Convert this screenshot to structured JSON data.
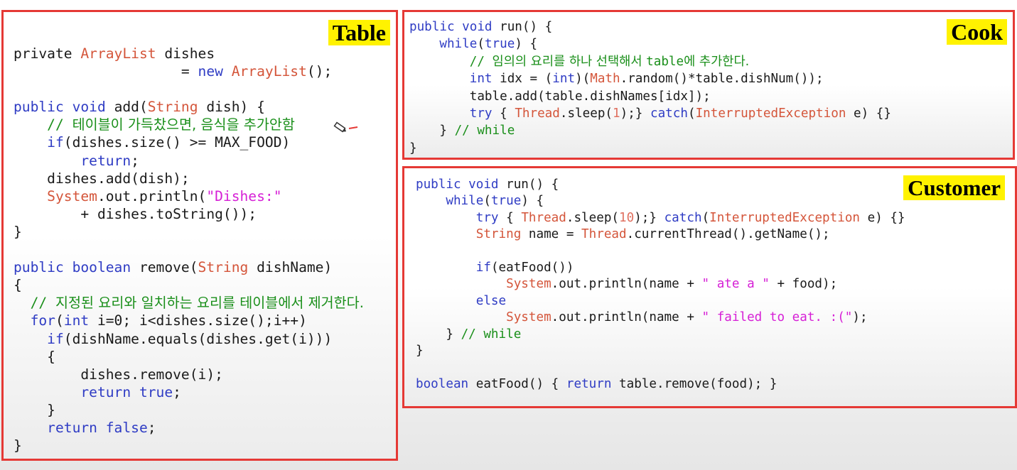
{
  "panels": {
    "table": {
      "tag": "Table"
    },
    "cook": {
      "tag": "Cook"
    },
    "customer": {
      "tag": "Customer"
    }
  },
  "code": {
    "table": [
      [
        [
          "",
          "private "
        ],
        [
          "ty",
          "ArrayList"
        ],
        [
          "",
          " dishes"
        ]
      ],
      [
        [
          "",
          "                    = "
        ],
        [
          "kw",
          "new "
        ],
        [
          "ty",
          "ArrayList"
        ],
        [
          "",
          "();"
        ]
      ],
      [],
      [
        [
          "kw",
          "public void "
        ],
        [
          "",
          "add("
        ],
        [
          "ty",
          "String"
        ],
        [
          "",
          " dish) {"
        ]
      ],
      [
        [
          "cm",
          "    // "
        ],
        [
          "cm-kr",
          "테이블이 가득찼으면, 음식을 추가안함"
        ]
      ],
      [
        [
          "kw",
          "    if"
        ],
        [
          "",
          "(dishes.size() >= MAX_FOOD)"
        ]
      ],
      [
        [
          "kw",
          "        return"
        ],
        [
          "",
          ";"
        ]
      ],
      [
        [
          "",
          "    dishes.add(dish);"
        ]
      ],
      [
        [
          "ty",
          "    System"
        ],
        [
          "",
          ".out.println("
        ],
        [
          "st",
          "\"Dishes:\""
        ]
      ],
      [
        [
          "",
          "        + dishes.toString());"
        ]
      ],
      [
        [
          "",
          "}"
        ]
      ],
      [],
      [
        [
          "kw",
          "public boolean "
        ],
        [
          "",
          "remove("
        ],
        [
          "ty",
          "String"
        ],
        [
          "",
          " dishName)"
        ]
      ],
      [
        [
          "",
          "{"
        ]
      ],
      [
        [
          "cm",
          "  // "
        ],
        [
          "cm-kr",
          "지정된 요리와 일치하는 요리를 테이블에서 제거한다."
        ]
      ],
      [
        [
          "kw",
          "  for"
        ],
        [
          "",
          "("
        ],
        [
          "kw",
          "int"
        ],
        [
          "",
          " i=0; i<dishes.size();i++)"
        ]
      ],
      [
        [
          "kw",
          "    if"
        ],
        [
          "",
          "(dishName.equals(dishes.get(i)))"
        ]
      ],
      [
        [
          "",
          "    {"
        ]
      ],
      [
        [
          "",
          "        dishes.remove(i);"
        ]
      ],
      [
        [
          "kw",
          "        return true"
        ],
        [
          "",
          ";"
        ]
      ],
      [
        [
          "",
          "    }"
        ]
      ],
      [
        [
          "kw",
          "    return false"
        ],
        [
          "",
          ";"
        ]
      ],
      [
        [
          "",
          "}"
        ]
      ]
    ],
    "cook": [
      [
        [
          "kw",
          "public void "
        ],
        [
          "",
          "run() {"
        ]
      ],
      [
        [
          "kw",
          "    while"
        ],
        [
          "",
          "("
        ],
        [
          "kw",
          "true"
        ],
        [
          "",
          ") {"
        ]
      ],
      [
        [
          "cm",
          "        // "
        ],
        [
          "cm-kr",
          "임의의 요리를 하나 선택해서 "
        ],
        [
          "cm",
          "table"
        ],
        [
          "cm-kr",
          "에 추가한다."
        ]
      ],
      [
        [
          "kw",
          "        int"
        ],
        [
          "",
          " idx = ("
        ],
        [
          "kw",
          "int"
        ],
        [
          "",
          ")("
        ],
        [
          "ty",
          "Math"
        ],
        [
          "",
          ".random()*table.dishNum());"
        ]
      ],
      [
        [
          "",
          "        table.add(table.dishNames[idx]);"
        ]
      ],
      [
        [
          "kw",
          "        try"
        ],
        [
          "",
          " { "
        ],
        [
          "ty",
          "Thread"
        ],
        [
          "",
          ".sleep("
        ],
        [
          "nm",
          "1"
        ],
        [
          "",
          ");} "
        ],
        [
          "kw",
          "catch"
        ],
        [
          "",
          "("
        ],
        [
          "ty",
          "InterruptedException"
        ],
        [
          "",
          " e) {}"
        ]
      ],
      [
        [
          "",
          "    } "
        ],
        [
          "cm",
          "// while"
        ]
      ],
      [
        [
          "",
          "}"
        ]
      ]
    ],
    "customer": [
      [
        [
          "kw",
          "public void "
        ],
        [
          "",
          "run() {"
        ]
      ],
      [
        [
          "kw",
          "    while"
        ],
        [
          "",
          "("
        ],
        [
          "kw",
          "true"
        ],
        [
          "",
          ") {"
        ]
      ],
      [
        [
          "kw",
          "        try"
        ],
        [
          "",
          " { "
        ],
        [
          "ty",
          "Thread"
        ],
        [
          "",
          ".sleep("
        ],
        [
          "nm",
          "10"
        ],
        [
          "",
          ");} "
        ],
        [
          "kw",
          "catch"
        ],
        [
          "",
          "("
        ],
        [
          "ty",
          "InterruptedException"
        ],
        [
          "",
          " e) {}"
        ]
      ],
      [
        [
          "ty",
          "        String"
        ],
        [
          "",
          " name = "
        ],
        [
          "ty",
          "Thread"
        ],
        [
          "",
          ".currentThread().getName();"
        ]
      ],
      [],
      [
        [
          "kw",
          "        if"
        ],
        [
          "",
          "(eatFood())"
        ]
      ],
      [
        [
          "ty",
          "            System"
        ],
        [
          "",
          ".out.println(name + "
        ],
        [
          "st",
          "\" ate a \""
        ],
        [
          "",
          " + food);"
        ]
      ],
      [
        [
          "kw",
          "        else"
        ]
      ],
      [
        [
          "ty",
          "            System"
        ],
        [
          "",
          ".out.println(name + "
        ],
        [
          "st",
          "\" failed to eat. :(\""
        ],
        [
          "",
          ");"
        ]
      ],
      [
        [
          "",
          "    } "
        ],
        [
          "cm",
          "// while"
        ]
      ],
      [
        [
          "",
          "}"
        ]
      ],
      [],
      [
        [
          "kw",
          "boolean "
        ],
        [
          "",
          "eatFood() { "
        ],
        [
          "kw",
          "return "
        ],
        [
          "",
          "table.remove(food); }"
        ]
      ]
    ]
  }
}
